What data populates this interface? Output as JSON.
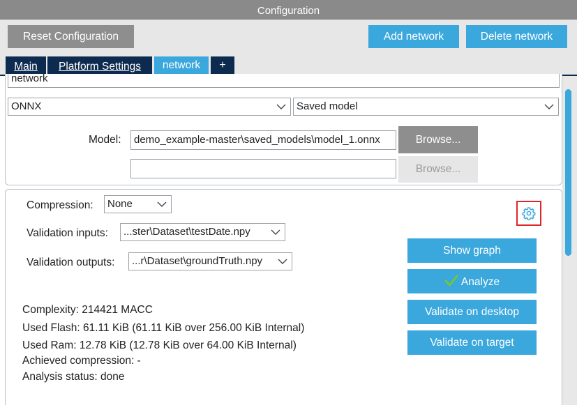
{
  "window": {
    "title": "Configuration"
  },
  "toolbar": {
    "reset_label": "Reset Configuration",
    "add_network_label": "Add network",
    "delete_network_label": "Delete network"
  },
  "tabs": [
    {
      "label": "Main"
    },
    {
      "label": "Platform Settings"
    },
    {
      "label": "network",
      "active": true
    },
    {
      "label": "+"
    }
  ],
  "network": {
    "name": "network",
    "framework": "ONNX",
    "model_type": "Saved model",
    "model_label": "Model:",
    "model_path": "demo_example-master\\saved_models\\model_1.onnx",
    "model_path2": "",
    "browse_label": "Browse...",
    "browse2_label": "Browse..."
  },
  "settings": {
    "compression_label": "Compression:",
    "compression_value": "None",
    "validation_inputs_label": "Validation inputs:",
    "validation_inputs_value": "...ster\\Dataset\\testDate.npy",
    "validation_outputs_label": "Validation outputs:",
    "validation_outputs_value": "...r\\Dataset\\groundTruth.npy"
  },
  "actions": {
    "show_graph": "Show graph",
    "analyze": "Analyze",
    "validate_desktop": "Validate on desktop",
    "validate_target": "Validate on target"
  },
  "results": {
    "complexity": "Complexity:  214421 MACC",
    "used_flash": "Used Flash: 61.11 KiB (61.11 KiB over 256.00 KiB Internal)",
    "used_ram": "Used Ram: 12.78 KiB (12.78 KiB over 64.00 KiB Internal)",
    "achieved_compression": "Achieved compression: -",
    "analysis_status": "Analysis status: done"
  },
  "colors": {
    "accent": "#3aa7dd",
    "tab_dark": "#0d2a4f",
    "highlight": "#e0262a"
  }
}
